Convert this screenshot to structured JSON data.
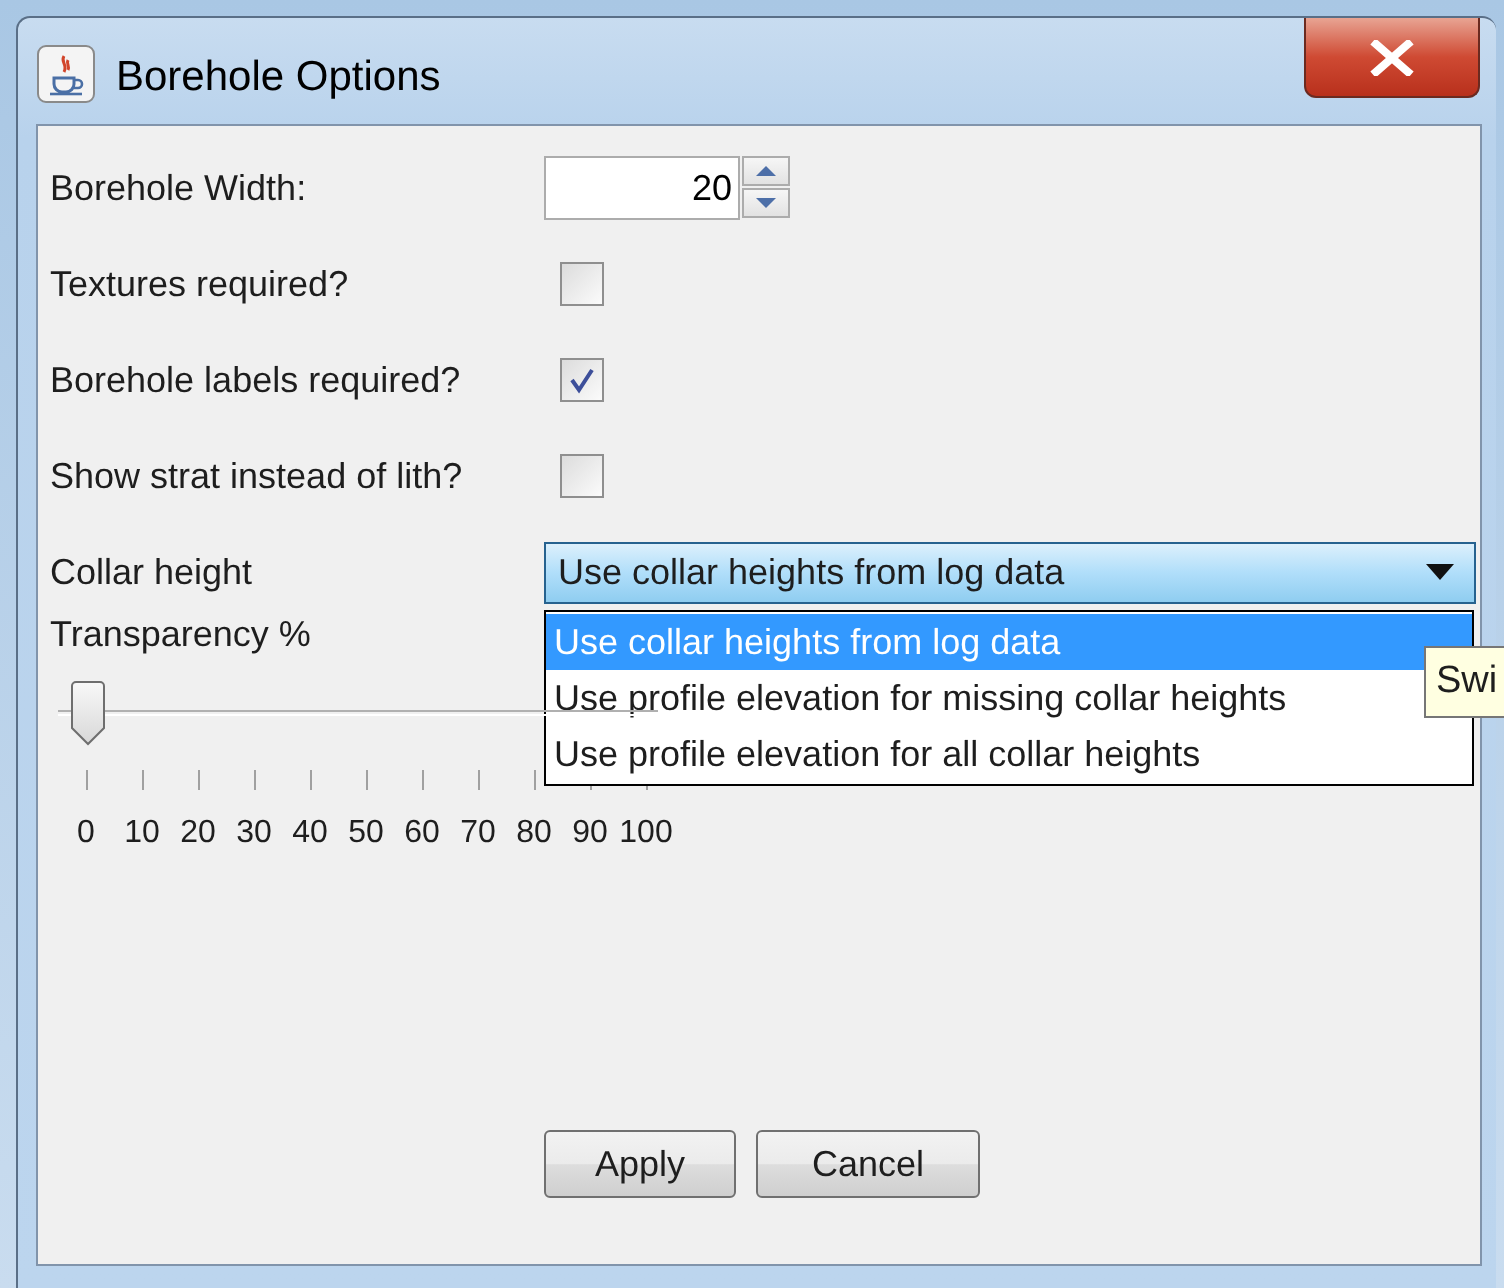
{
  "window": {
    "title": "Borehole Options"
  },
  "fields": [
    {
      "kind": "spinner",
      "label": "Borehole Width:",
      "value": "20"
    },
    {
      "kind": "checkbox",
      "label": "Textures required?",
      "checked": false
    },
    {
      "kind": "checkbox",
      "label": "Borehole labels required?",
      "checked": true
    },
    {
      "kind": "checkbox",
      "label": "Show strat instead of lith?",
      "checked": false
    },
    {
      "kind": "dropdown",
      "label": "Collar height",
      "value": "Use collar heights from log data",
      "expanded": true,
      "options": [
        {
          "label": "Use collar heights from log data",
          "selected": true
        },
        {
          "label": "Use profile elevation for missing collar heights",
          "selected": false
        },
        {
          "label": "Use profile elevation for all collar heights",
          "selected": false
        }
      ]
    },
    {
      "kind": "slider",
      "label": "Transparency %",
      "level": 0,
      "tick_labels": [
        "0",
        "10",
        "20",
        "30",
        "40",
        "50",
        "60",
        "70",
        "80",
        "90",
        "100"
      ]
    }
  ],
  "tooltip": {
    "text": "Swi"
  },
  "buttons": [
    {
      "label": "Apply"
    },
    {
      "label": "Cancel"
    }
  ]
}
